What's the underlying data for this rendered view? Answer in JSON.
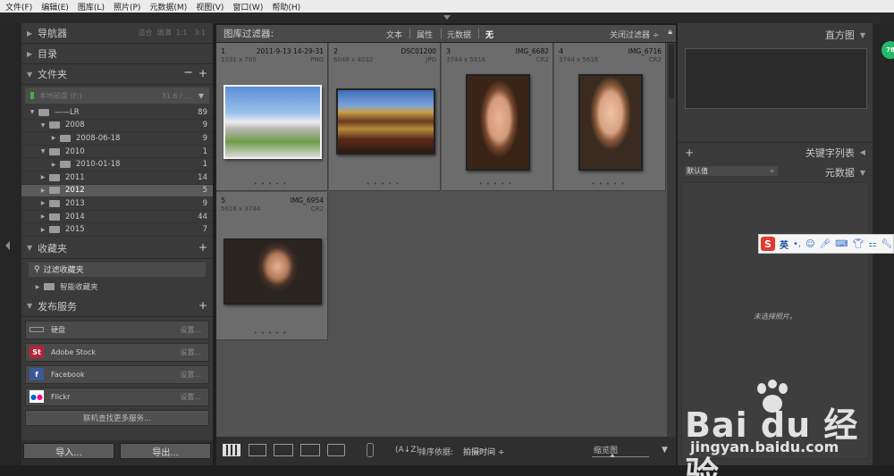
{
  "menu": [
    "文件(F)",
    "编辑(E)",
    "图库(L)",
    "照片(P)",
    "元数据(M)",
    "视图(V)",
    "窗口(W)",
    "帮助(H)"
  ],
  "left": {
    "navigator": {
      "title": "导航器",
      "zoom_options": [
        "适合",
        "填满",
        "1:1",
        "3:1"
      ]
    },
    "catalog": {
      "title": "目录"
    },
    "folders": {
      "title": "文件夹",
      "volume": {
        "name": "本地磁盘 (F:)",
        "size": "31.6 / ..."
      },
      "items": [
        {
          "name": "——LR",
          "count": "89",
          "level": 0,
          "expanded": true
        },
        {
          "name": "2008",
          "count": "9",
          "level": 1,
          "expanded": true
        },
        {
          "name": "2008-06-18",
          "count": "9",
          "level": 2,
          "expanded": false
        },
        {
          "name": "2010",
          "count": "1",
          "level": 1,
          "expanded": true
        },
        {
          "name": "2010-01-18",
          "count": "1",
          "level": 2,
          "expanded": false
        },
        {
          "name": "2011",
          "count": "14",
          "level": 1,
          "expanded": false
        },
        {
          "name": "2012",
          "count": "5",
          "level": 1,
          "expanded": false,
          "selected": true
        },
        {
          "name": "2013",
          "count": "9",
          "level": 1,
          "expanded": false
        },
        {
          "name": "2014",
          "count": "44",
          "level": 1,
          "expanded": false
        },
        {
          "name": "2015",
          "count": "7",
          "level": 1,
          "expanded": false
        }
      ]
    },
    "collections": {
      "title": "收藏夹",
      "filter_label": "过滤收藏夹",
      "items": [
        {
          "name": "智能收藏夹"
        }
      ]
    },
    "publish": {
      "title": "发布服务",
      "items": [
        {
          "name": "硬盘",
          "setting": "设置...",
          "icon": "hard-disk-icon",
          "color": "#6a6a6a"
        },
        {
          "name": "Adobe Stock",
          "setting": "设置...",
          "icon": "adobe-stock-icon",
          "color": "#b2263a"
        },
        {
          "name": "Facebook",
          "setting": "设置...",
          "icon": "facebook-icon",
          "color": "#3b5998"
        },
        {
          "name": "Flickr",
          "setting": "设置...",
          "icon": "flickr-icon",
          "color": "#ffffff"
        }
      ],
      "more": "联机查找更多服务..."
    },
    "import_label": "导入...",
    "export_label": "导出..."
  },
  "filter_bar": {
    "title": "图库过滤器:",
    "options": [
      "文本",
      "属性",
      "元数据",
      "无"
    ],
    "active": "无",
    "close_label": "关闭过滤器 ÷"
  },
  "grid": [
    {
      "index": "1",
      "name": "2011-9-13 14-29-31",
      "dims": "1031 x 780",
      "ext": "PNG"
    },
    {
      "index": "2",
      "name": "DSC01200",
      "dims": "6048 x 4032",
      "ext": "JPG"
    },
    {
      "index": "3",
      "name": "IMG_6682",
      "dims": "3744 x 5616",
      "ext": "CR2"
    },
    {
      "index": "4",
      "name": "IMG_6716",
      "dims": "3744 x 5616",
      "ext": "CR2"
    },
    {
      "index": "5",
      "name": "IMG_6954",
      "dims": "5616 x 3744",
      "ext": "CR2"
    }
  ],
  "toolbar": {
    "sort_label": "排序依据:",
    "sort_value": "拍摄时间 ÷",
    "zoom_label": "缩览图"
  },
  "right": {
    "histogram": "直方图",
    "keyword_list": "关键字列表",
    "metadata": "元数据",
    "metadata_preset": "默认值",
    "no_selection": "未选择照片。"
  },
  "ime": {
    "logo": "S",
    "lang": "英"
  },
  "badge": "78",
  "watermark": {
    "logo": "Bai du 经验",
    "url": "jingyan.baidu.com"
  }
}
